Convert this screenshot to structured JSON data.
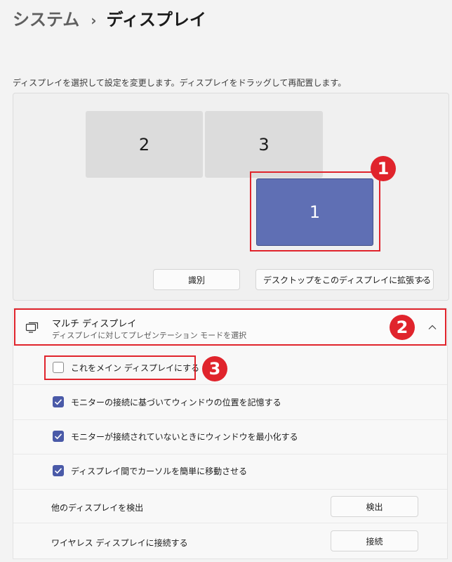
{
  "breadcrumb": {
    "parent": "システム",
    "separator": "›",
    "current": "ディスプレイ"
  },
  "description": "ディスプレイを選択して設定を変更します。ディスプレイをドラッグして再配置します。",
  "monitors": [
    {
      "label": "2",
      "selected": false
    },
    {
      "label": "3",
      "selected": false
    },
    {
      "label": "1",
      "selected": true
    }
  ],
  "buttons": {
    "identify": "識別",
    "extend_dropdown": "デスクトップをこのディスプレイに拡張する"
  },
  "badges": {
    "one": "1",
    "two": "2",
    "three": "3"
  },
  "multi_display": {
    "title": "マルチ ディスプレイ",
    "subtitle": "ディスプレイに対してプレゼンテーション モードを選択",
    "expanded": true,
    "options": [
      {
        "label": "これをメイン ディスプレイにする",
        "checked": false
      },
      {
        "label": "モニターの接続に基づいてウィンドウの位置を記憶する",
        "checked": true
      },
      {
        "label": "モニターが接続されていないときにウィンドウを最小化する",
        "checked": true
      },
      {
        "label": "ディスプレイ間でカーソルを簡単に移動させる",
        "checked": true
      }
    ],
    "detect": {
      "label": "他のディスプレイを検出",
      "button": "検出"
    },
    "wireless": {
      "label": "ワイヤレス ディスプレイに接続する",
      "button": "接続"
    }
  },
  "colors": {
    "accent": "#4a5aa8",
    "selected_monitor": "#5f6fb4",
    "annotation_red": "#e0242c"
  },
  "icons": {
    "multi_display": "multi-display-icon",
    "chevron_up": "chevron-up-icon",
    "chevron_down": "chevron-down-icon",
    "checkmark": "checkmark-icon"
  }
}
